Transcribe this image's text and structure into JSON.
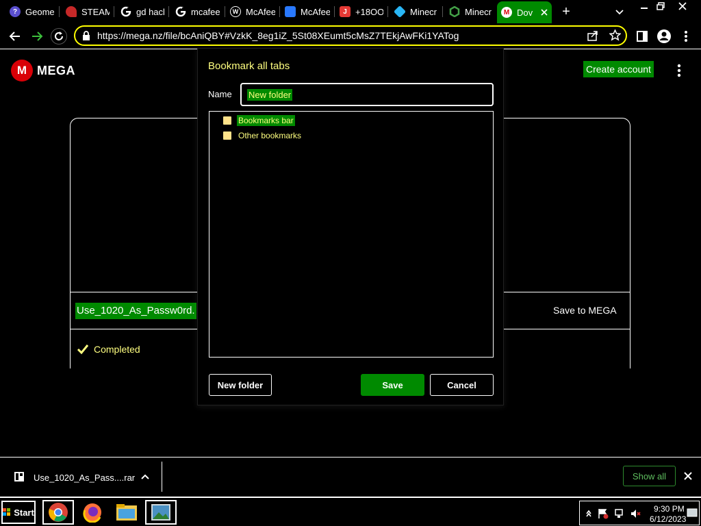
{
  "tabs": [
    {
      "title": "Geome",
      "icon": "help-circle-icon",
      "color": "#5a4fcf"
    },
    {
      "title": "STEAM",
      "icon": "steam-icon",
      "color": "#c62828"
    },
    {
      "title": "gd hack",
      "icon": "google-icon",
      "color": "#ffffff"
    },
    {
      "title": "mcafee",
      "icon": "google-icon",
      "color": "#ffffff"
    },
    {
      "title": "McAfee",
      "icon": "wordpress-icon",
      "color": "#ffffff"
    },
    {
      "title": "McAfee",
      "icon": "mcafee-site-icon",
      "color": "#2979ff"
    },
    {
      "title": "+18OO",
      "icon": "j-icon",
      "color": "#e53935"
    },
    {
      "title": "Minecr",
      "icon": "minecraft-cube-icon",
      "color": "#29b6f6"
    },
    {
      "title": "Minecr",
      "icon": "hexagon-icon",
      "color": "#43a047"
    },
    {
      "title": "Dov",
      "icon": "mega-icon",
      "color": "#d90007",
      "active": true
    }
  ],
  "toolbar": {
    "url": "https://mega.nz/file/bcAniQBY#VzkK_8eg1iZ_5St08XEumt5cMsZ7TEkjAwFKi1YATog"
  },
  "mega": {
    "logo_letter": "M",
    "logo_text": "MEGA",
    "create_account": "Create account",
    "file_name": "Use_1020_As_Passw0rd.",
    "save_to_mega": "Save to MEGA",
    "status": "Completed"
  },
  "dialog": {
    "title": "Bookmark all tabs",
    "name_label": "Name",
    "name_value": "New folder",
    "folders": [
      "Bookmarks bar",
      "Other bookmarks"
    ],
    "new_folder_button": "New folder",
    "save_button": "Save",
    "cancel_button": "Cancel"
  },
  "download": {
    "file": "Use_1020_As_Pass....rar",
    "show_all": "Show all"
  },
  "taskbar": {
    "start": "Start",
    "time": "9:30 PM",
    "date": "6/12/2023"
  },
  "colors": {
    "accent_green": "#008a00",
    "highlight_yellow": "#ffff80",
    "mega_red": "#d90007"
  }
}
